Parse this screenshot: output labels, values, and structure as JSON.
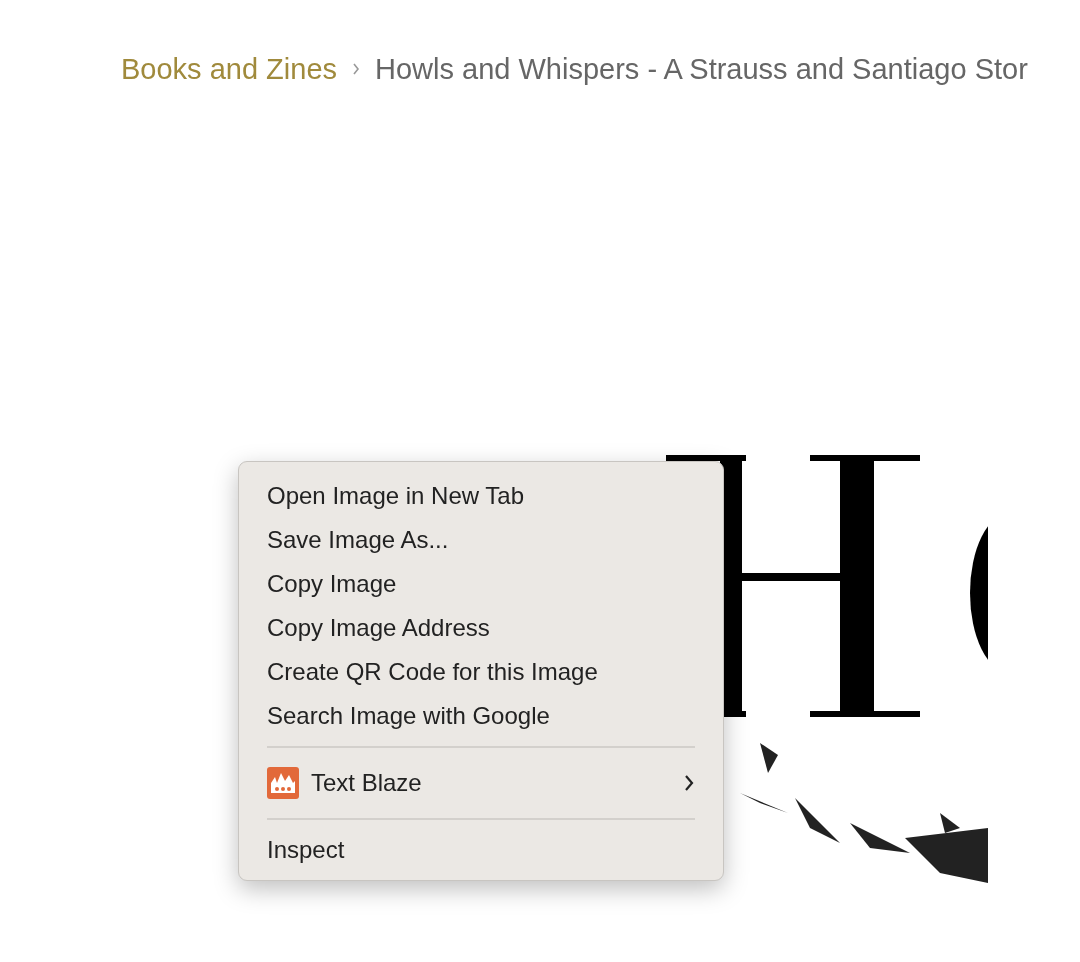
{
  "breadcrumb": [
    {
      "label": "Books and Zines",
      "kind": "link"
    },
    {
      "label": "Howls and Whispers - A Strauss and Santiago Stor",
      "kind": "current"
    }
  ],
  "context_menu": {
    "items": [
      {
        "kind": "item",
        "label": "Open Image in New Tab"
      },
      {
        "kind": "item",
        "label": "Save Image As..."
      },
      {
        "kind": "item",
        "label": "Copy Image"
      },
      {
        "kind": "item",
        "label": "Copy Image Address"
      },
      {
        "kind": "item",
        "label": "Create QR Code for this Image"
      },
      {
        "kind": "item",
        "label": "Search Image with Google"
      },
      {
        "kind": "separator"
      },
      {
        "kind": "submenu",
        "label": "Text Blaze"
      },
      {
        "kind": "separator"
      },
      {
        "kind": "item",
        "label": "Inspect"
      }
    ]
  }
}
